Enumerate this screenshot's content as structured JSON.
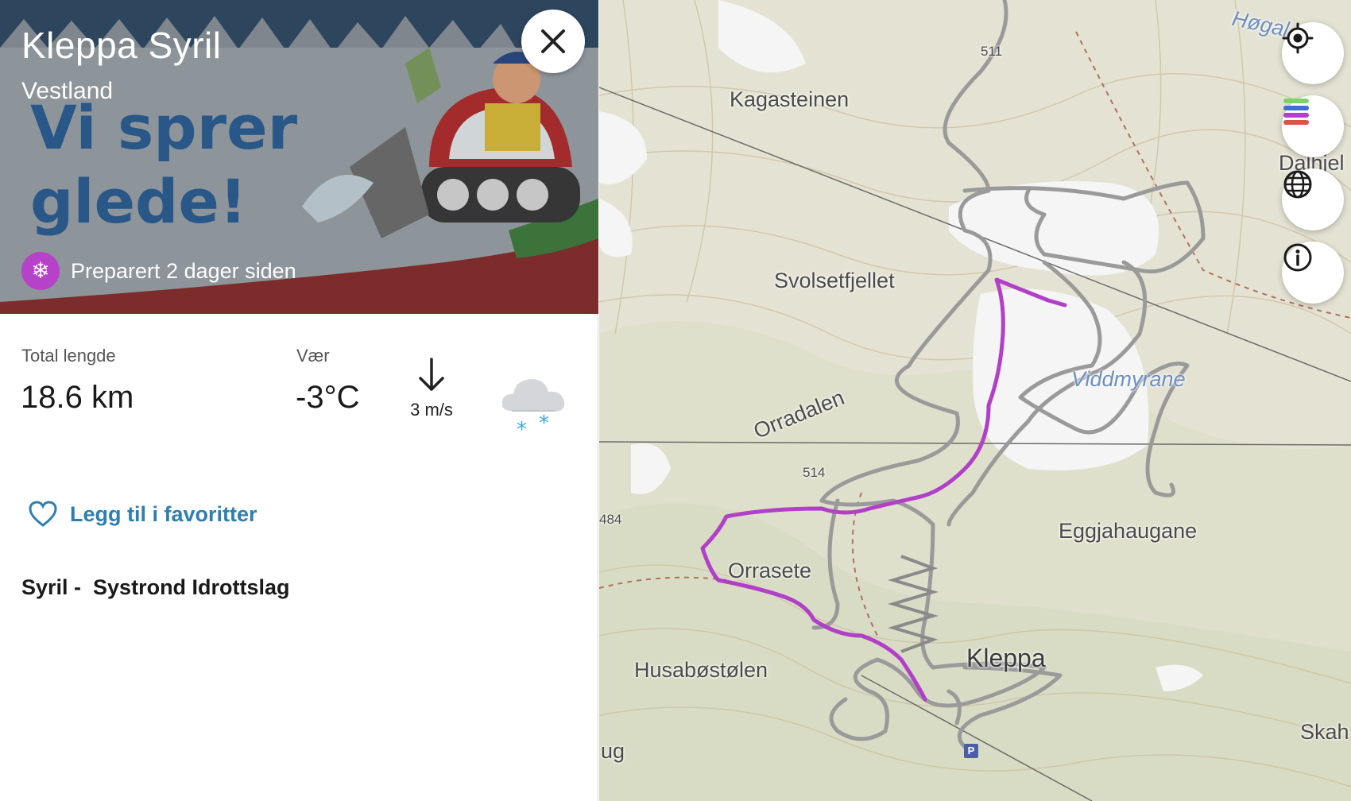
{
  "header": {
    "title": "Kleppa Syril",
    "region": "Vestland",
    "banner_text": [
      "Vi sprer",
      "glede!"
    ],
    "preparation_status": "Preparert 2 dager siden",
    "close_icon": "close-icon",
    "status_icon": "snowflake-icon"
  },
  "stats": {
    "length_label": "Total lengde",
    "length_value": "18.6 km",
    "weather_label": "Vær",
    "temperature": "-3°C",
    "wind_speed": "3 m/s",
    "wind_direction": "south",
    "weather_icon": "cloud-snow-icon"
  },
  "actions": {
    "favorite_label": "Legg til i favoritter",
    "favorite_icon": "heart-icon"
  },
  "organizer": "Syril -  Systrond Idrottslag",
  "map": {
    "place_labels": [
      "Kagasteinen",
      "Svolsetfjellet",
      "Orradalen",
      "Orrasete",
      "Husabøstølen",
      "Eggjahaugane",
      "Kleppa",
      "Viddmyrane",
      "Høgal",
      "Dalhjel",
      "Skah",
      "ug"
    ],
    "elevation_labels": [
      "511",
      "514",
      "484"
    ],
    "buttons": [
      "locate-icon",
      "layers-icon",
      "globe-icon",
      "info-icon"
    ],
    "colors": {
      "highlight_track": "#b13fc7",
      "other_tracks": "#9a9a9a",
      "terrain": "#e6e4d6",
      "accent": "#2c7fb0",
      "badge": "#b642c9"
    }
  }
}
